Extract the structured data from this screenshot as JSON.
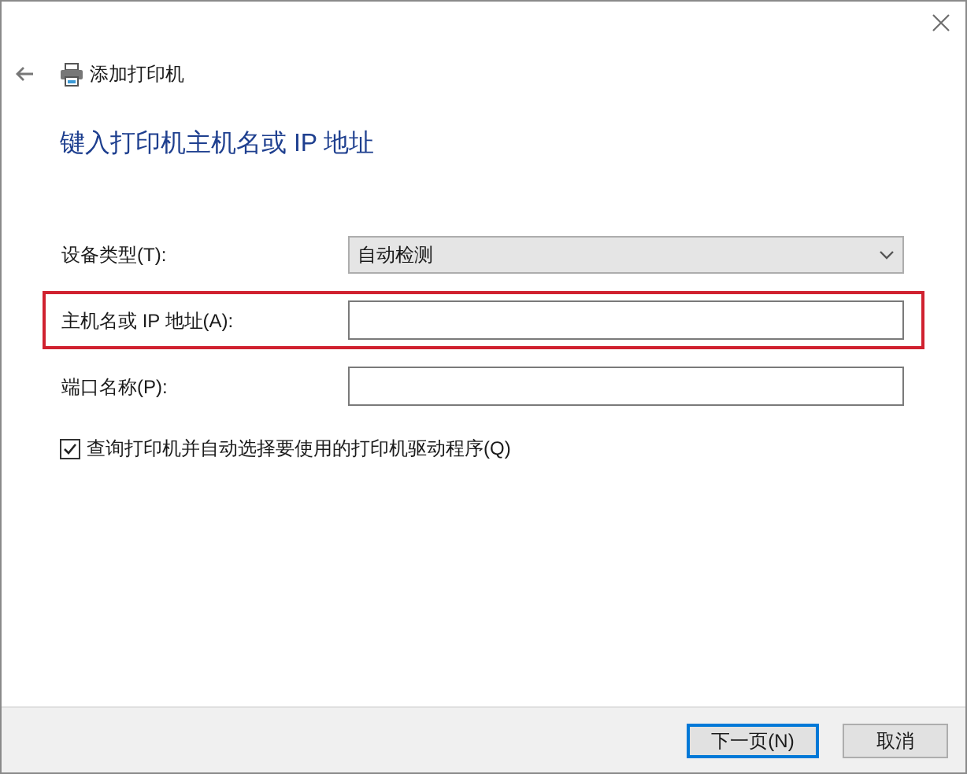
{
  "window": {
    "title": "添加打印机"
  },
  "heading": "键入打印机主机名或 IP 地址",
  "fields": [
    {
      "kind": "select",
      "label": "设备类型(T):",
      "value": "自动检测",
      "highlighted": false
    },
    {
      "kind": "text",
      "label": "主机名或 IP 地址(A):",
      "highlighted": true
    },
    {
      "kind": "text",
      "label": "端口名称(P):",
      "highlighted": false
    }
  ],
  "checkbox": {
    "label": "查询打印机并自动选择要使用的打印机驱动程序(Q)",
    "checked": true
  },
  "buttons": [
    {
      "label": "下一页(N)",
      "default": true
    },
    {
      "label": "取消",
      "default": false
    }
  ]
}
